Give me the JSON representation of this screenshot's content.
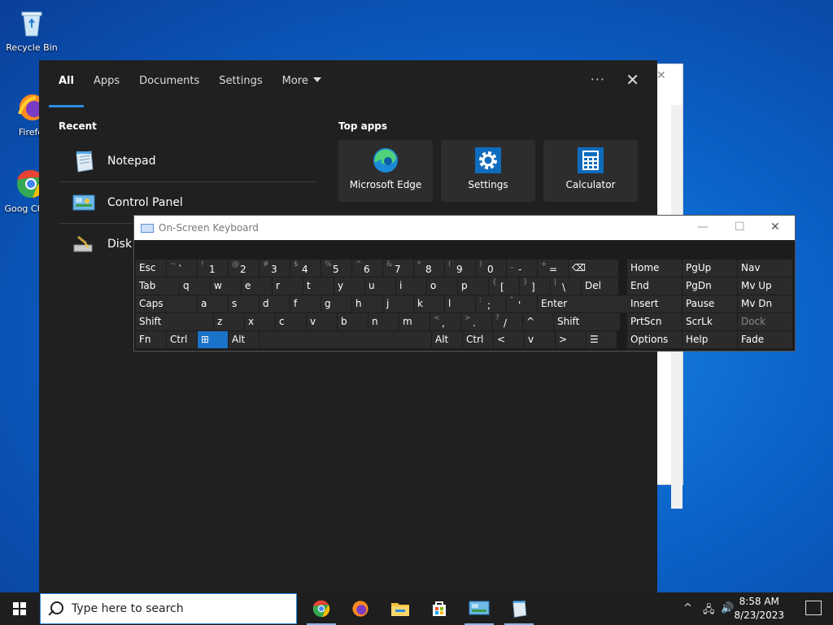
{
  "desktop": {
    "icons": [
      {
        "label": "Recycle Bin"
      },
      {
        "label": "Firefo"
      },
      {
        "label": "Goog Chron"
      }
    ]
  },
  "search_panel": {
    "tabs": [
      {
        "label": "All"
      },
      {
        "label": "Apps"
      },
      {
        "label": "Documents"
      },
      {
        "label": "Settings"
      },
      {
        "label": "More"
      }
    ],
    "more_options": "···",
    "close": "✕",
    "recent_title": "Recent",
    "recent": [
      {
        "label": "Notepad"
      },
      {
        "label": "Control Panel"
      },
      {
        "label": "Disk"
      }
    ],
    "top_apps_title": "Top apps",
    "top_apps": [
      {
        "label": "Microsoft Edge"
      },
      {
        "label": "Settings"
      },
      {
        "label": "Calculator"
      }
    ]
  },
  "osk": {
    "title": "On-Screen Keyboard",
    "minimize": "—",
    "maximize": "☐",
    "close": "✕",
    "rows": [
      [
        {
          "k": "Esc"
        },
        {
          "s": "~",
          "k": "`"
        },
        {
          "s": "!",
          "k": "1"
        },
        {
          "s": "@",
          "k": "2"
        },
        {
          "s": "#",
          "k": "3"
        },
        {
          "s": "$",
          "k": "4"
        },
        {
          "s": "%",
          "k": "5"
        },
        {
          "s": "^",
          "k": "6"
        },
        {
          "s": "&",
          "k": "7"
        },
        {
          "s": "*",
          "k": "8"
        },
        {
          "s": "(",
          "k": "9"
        },
        {
          "s": ")",
          "k": "0"
        },
        {
          "s": "_",
          "k": "-"
        },
        {
          "s": "+",
          "k": "="
        },
        {
          "k": "⌫"
        }
      ],
      [
        {
          "k": "Tab"
        },
        {
          "k": "q"
        },
        {
          "k": "w"
        },
        {
          "k": "e"
        },
        {
          "k": "r"
        },
        {
          "k": "t"
        },
        {
          "k": "y"
        },
        {
          "k": "u"
        },
        {
          "k": "i"
        },
        {
          "k": "o"
        },
        {
          "k": "p"
        },
        {
          "s": "{",
          "k": "["
        },
        {
          "s": "}",
          "k": "]"
        },
        {
          "s": "|",
          "k": "\\"
        },
        {
          "k": "Del"
        }
      ],
      [
        {
          "k": "Caps"
        },
        {
          "k": "a"
        },
        {
          "k": "s"
        },
        {
          "k": "d"
        },
        {
          "k": "f"
        },
        {
          "k": "g"
        },
        {
          "k": "h"
        },
        {
          "k": "j"
        },
        {
          "k": "k"
        },
        {
          "k": "l"
        },
        {
          "s": ":",
          "k": ";"
        },
        {
          "s": "\"",
          "k": "'"
        },
        {
          "k": "Enter"
        }
      ],
      [
        {
          "k": "Shift"
        },
        {
          "k": "z"
        },
        {
          "k": "x"
        },
        {
          "k": "c"
        },
        {
          "k": "v"
        },
        {
          "k": "b"
        },
        {
          "k": "n"
        },
        {
          "k": "m"
        },
        {
          "s": "<",
          "k": ","
        },
        {
          "s": ">",
          "k": "."
        },
        {
          "s": "?",
          "k": "/"
        },
        {
          "k": "^"
        },
        {
          "k": "Shift"
        }
      ],
      [
        {
          "k": "Fn"
        },
        {
          "k": "Ctrl"
        },
        {
          "k": "⊞"
        },
        {
          "k": "Alt"
        },
        {
          "k": ""
        },
        {
          "k": "Alt"
        },
        {
          "k": "Ctrl"
        },
        {
          "k": "<"
        },
        {
          "k": "v"
        },
        {
          "k": ">"
        },
        {
          "k": "☰"
        }
      ]
    ],
    "nav_keys": [
      [
        "Home",
        "PgUp",
        "Nav"
      ],
      [
        "End",
        "PgDn",
        "Mv Up"
      ],
      [
        "Insert",
        "Pause",
        "Mv Dn"
      ],
      [
        "PrtScn",
        "ScrLk",
        "Dock"
      ],
      [
        "Options",
        "Help",
        "Fade"
      ]
    ]
  },
  "taskbar": {
    "search_placeholder": "Type here to search",
    "time": "8:58 AM",
    "date": "8/23/2023"
  }
}
